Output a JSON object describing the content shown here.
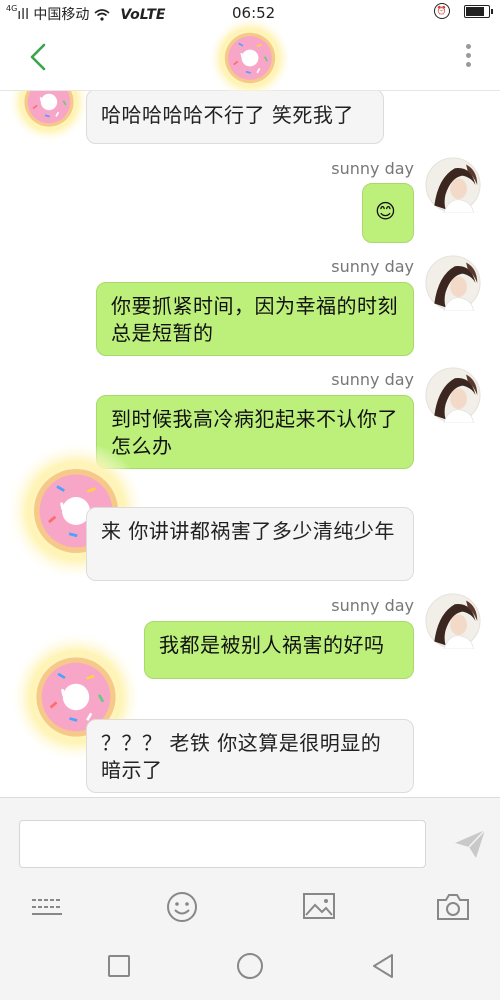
{
  "status_bar": {
    "signal_small": "4G",
    "carrier": "中国移动",
    "volte": "VoLTE",
    "time": "06:52",
    "battery_level": 0.85
  },
  "header": {
    "back_label": "back",
    "more_label": "more"
  },
  "messages": [
    {
      "direction": "in",
      "text": "哈哈哈哈哈不行了 笑死我了"
    },
    {
      "direction": "out",
      "sender": "sunny day",
      "text": "😊"
    },
    {
      "direction": "out",
      "sender": "sunny day",
      "text": "你要抓紧时间，因为幸福的时刻总是短暂的"
    },
    {
      "direction": "out",
      "sender": "sunny day",
      "text": "到时候我高冷病犯起来不认你了怎么办"
    },
    {
      "direction": "in",
      "text": "来 你讲讲都祸害了多少清纯少年"
    },
    {
      "direction": "out",
      "sender": "sunny day",
      "text": "我都是被别人祸害的好吗"
    },
    {
      "direction": "in",
      "text": "？？？ 老铁 你这算是很明显的暗示了"
    }
  ],
  "composer": {
    "input_value": "",
    "input_placeholder": ""
  },
  "icons": {
    "back": "chevron-left-icon",
    "more": "more-vertical-icon",
    "send": "send-icon",
    "keyboard": "keyboard-icon",
    "emoji": "emoji-icon",
    "image": "image-icon",
    "camera": "camera-icon",
    "recent": "square-icon",
    "home": "circle-icon",
    "nav_back": "triangle-back-icon"
  },
  "colors": {
    "outgoing_bubble": "#bdf07b",
    "incoming_bubble": "#f5f5f5",
    "accent_green": "#4caf50"
  }
}
